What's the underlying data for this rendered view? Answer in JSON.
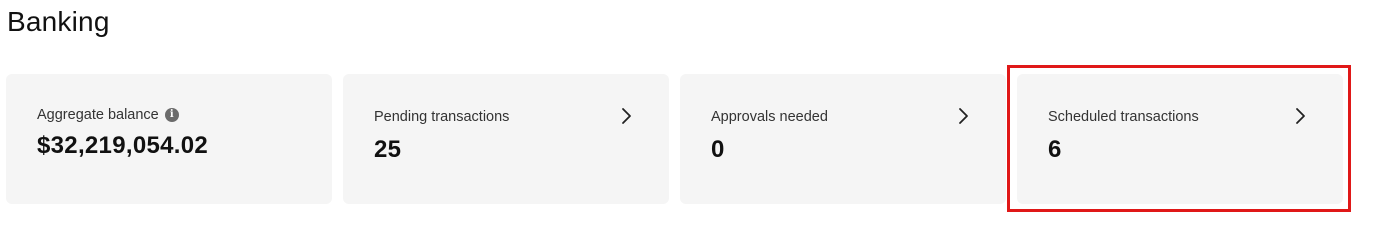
{
  "page": {
    "title": "Banking"
  },
  "cards": [
    {
      "label": "Aggregate balance",
      "value": "$32,219,054.02",
      "has_info_icon": true,
      "has_chevron": false
    },
    {
      "label": "Pending transactions",
      "value": "25",
      "has_chevron": true
    },
    {
      "label": "Approvals needed",
      "value": "0",
      "has_chevron": true
    },
    {
      "label": "Scheduled transactions",
      "value": "6",
      "has_chevron": true,
      "highlighted": true
    }
  ],
  "icons": {
    "info": "info-icon",
    "chevron": "chevron-right-icon"
  },
  "colors": {
    "card_background": "#f5f5f5",
    "highlight_border": "#e01818"
  }
}
